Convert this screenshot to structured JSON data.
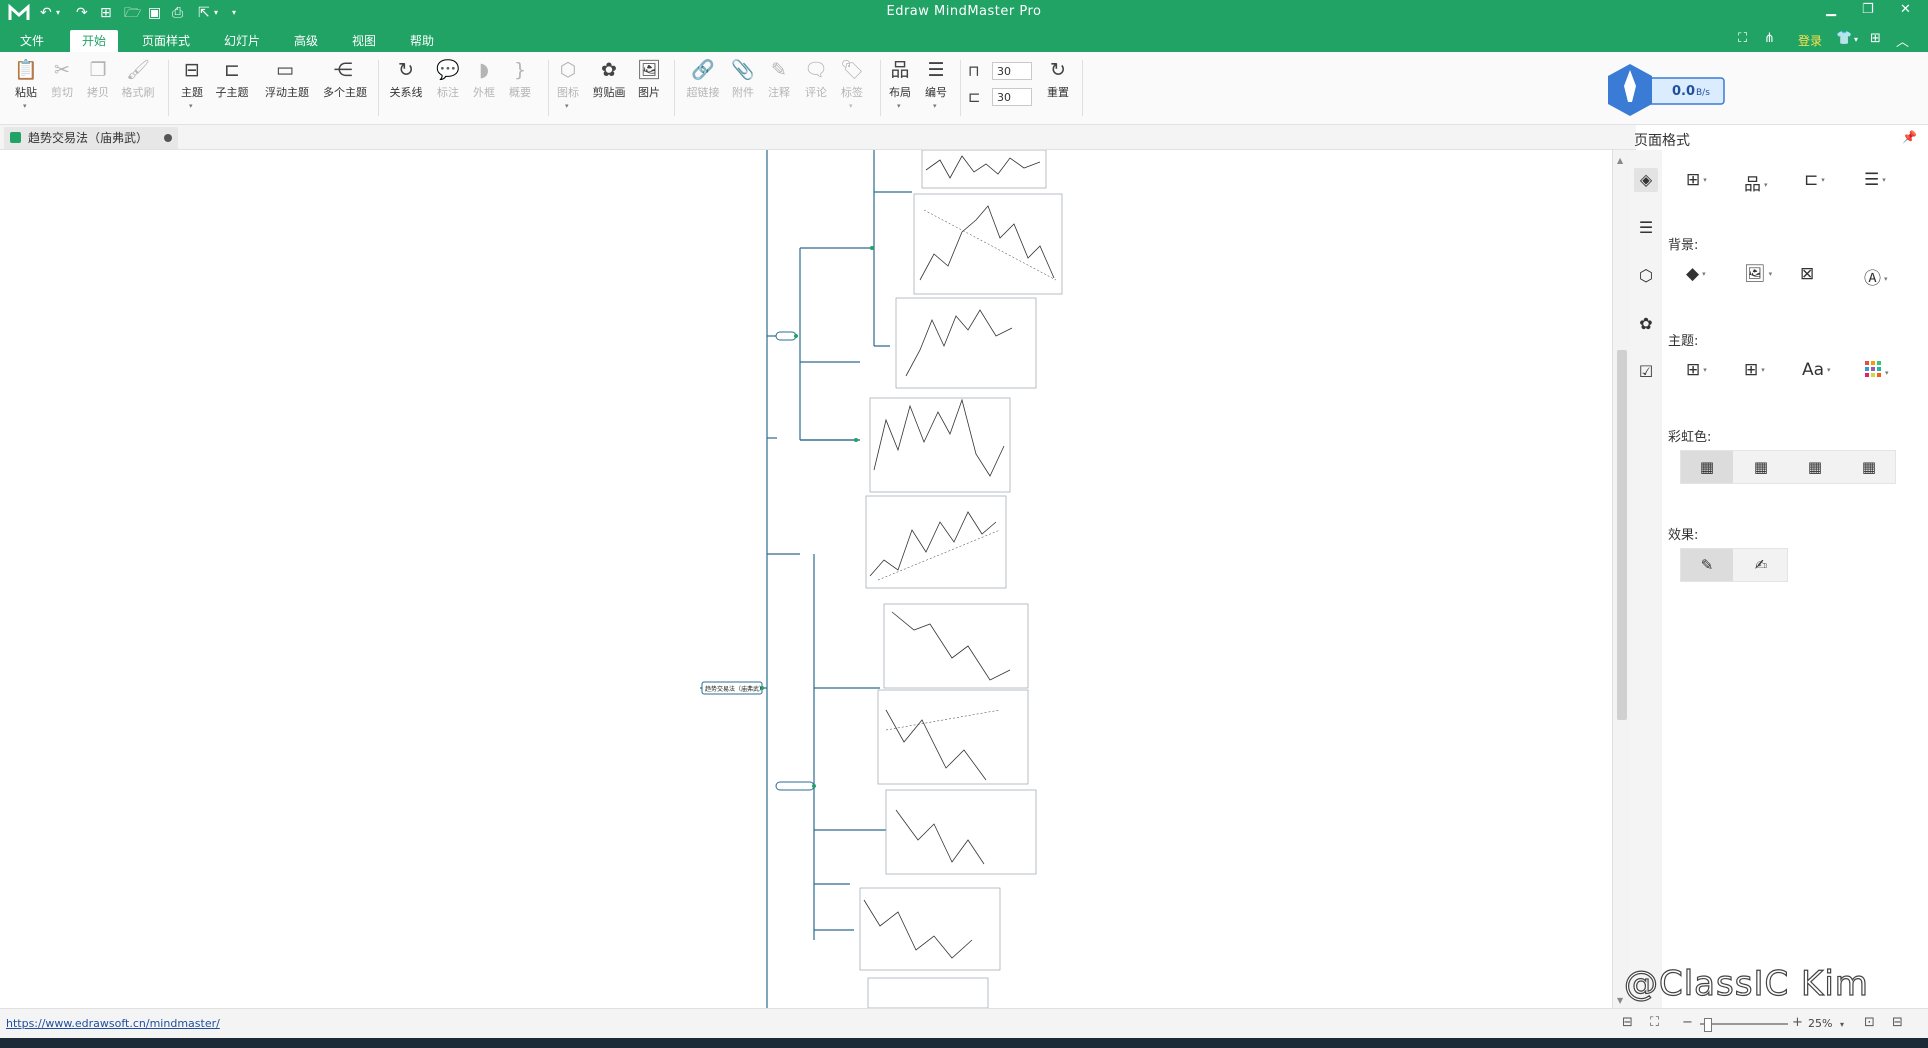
{
  "app": {
    "title": "Edraw MindMaster Pro",
    "login": "登录"
  },
  "menu": {
    "items": [
      "文件",
      "开始",
      "页面样式",
      "幻灯片",
      "高级",
      "视图",
      "帮助"
    ],
    "active": "开始"
  },
  "ribbon": {
    "paste": "粘贴",
    "cut": "剪切",
    "copy": "拷贝",
    "format_painter": "格式刷",
    "topic": "主题",
    "subtopic": "子主题",
    "floating_topic": "浮动主题",
    "multiple_topics": "多个主题",
    "relationship": "关系线",
    "callout": "标注",
    "boundary": "外框",
    "summary": "概要",
    "icon": "图标",
    "clipart": "剪贴画",
    "picture": "图片",
    "hyperlink": "超链接",
    "attachment": "附件",
    "note": "注释",
    "comment": "评论",
    "tag": "标签",
    "layout": "布局",
    "numbering": "编号",
    "h_spacing": "30",
    "v_spacing": "30",
    "reset": "重置"
  },
  "speed_badge": {
    "value": "0.0",
    "unit": "B/s"
  },
  "document_tab": {
    "title": "趋势交易法（庙弗武）"
  },
  "mindmap": {
    "root_label": "趋势交易法（庙弗武）"
  },
  "panel": {
    "title": "页面格式",
    "background_label": "背景:",
    "theme_label": "主题:",
    "rainbow_label": "彩虹色:",
    "effect_label": "效果:",
    "font_glyph": "Aa"
  },
  "status": {
    "url": "https://www.edrawsoft.cn/mindmaster/",
    "zoom": "25%"
  },
  "watermark": "@ClassIC Kim",
  "colors": {
    "brand": "#21a366",
    "connector": "#2c6b8f",
    "login": "#ffe14a"
  }
}
